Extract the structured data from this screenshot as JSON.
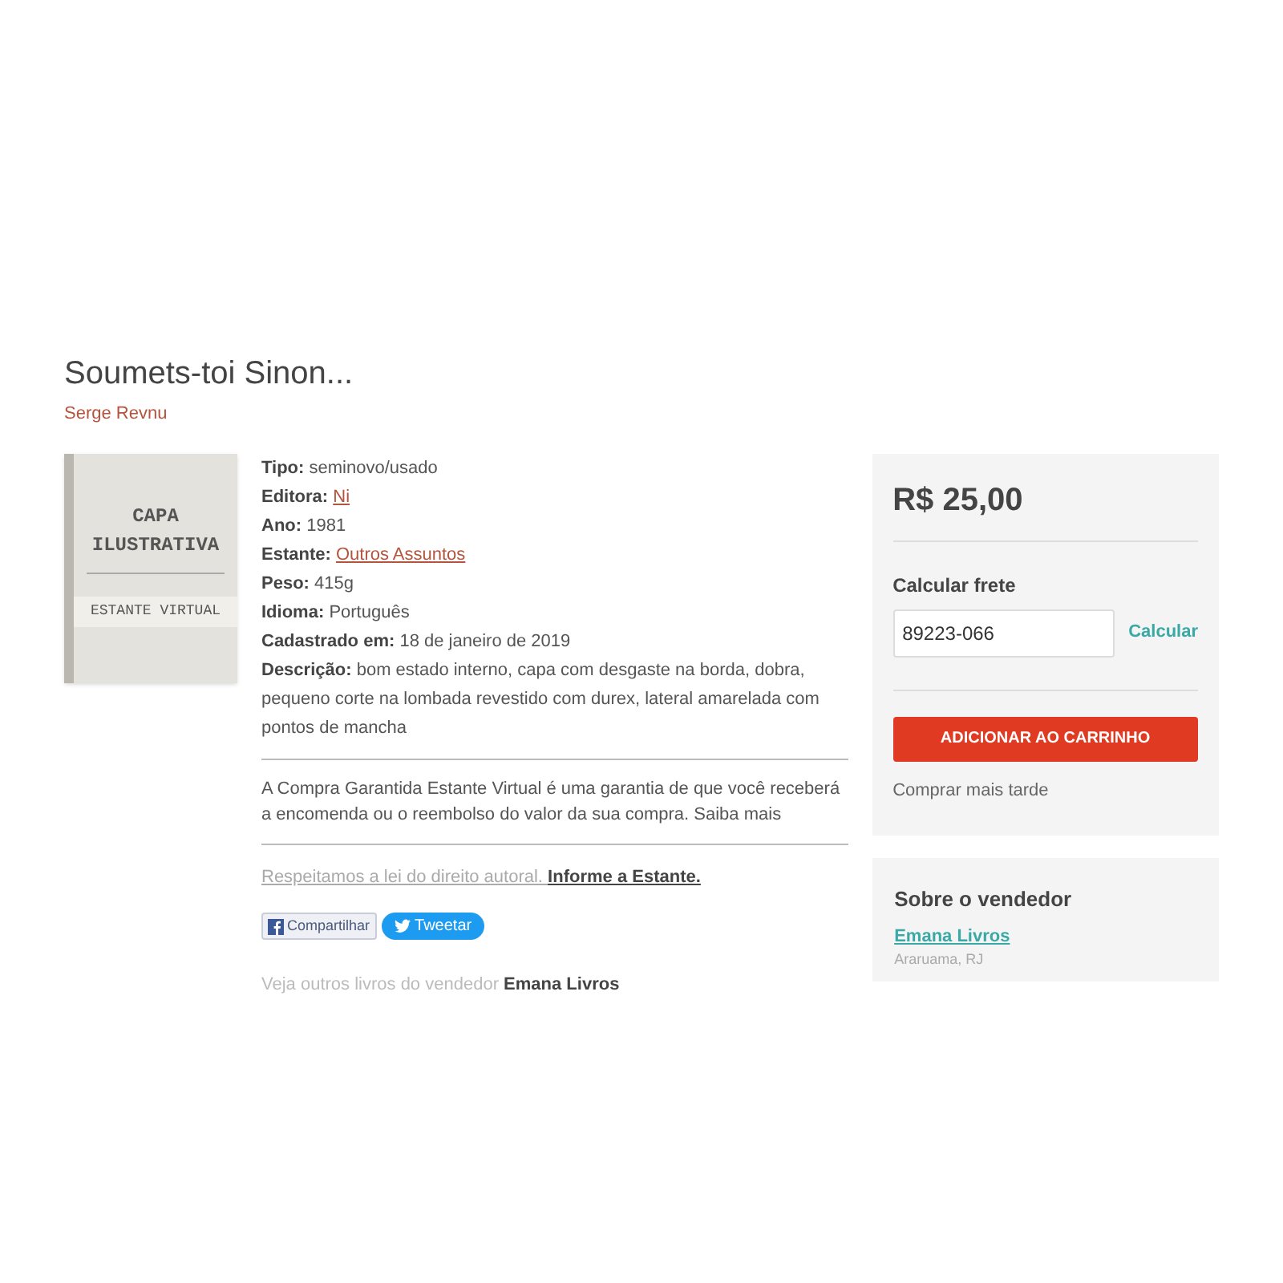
{
  "book": {
    "title": "Soumets-toi Sinon...",
    "author": "Serge Revnu"
  },
  "cover": {
    "line_1": "CAPA",
    "line_2": "ILUSTRATIVA",
    "footer": "ESTANTE VIRTUAL"
  },
  "details": [
    {
      "label": "Tipo:",
      "value": "seminovo/usado",
      "kind": "text"
    },
    {
      "label": "Editora:",
      "value": "Ni",
      "kind": "link"
    },
    {
      "label": "Ano:",
      "value": "1981",
      "kind": "text"
    },
    {
      "label": "Estante:",
      "value": "Outros Assuntos",
      "kind": "link"
    },
    {
      "label": "Peso:",
      "value": "415g",
      "kind": "text"
    },
    {
      "label": "Idioma:",
      "value": "Português",
      "kind": "text"
    },
    {
      "label": "Cadastrado em:",
      "value": "18 de janeiro de 2019",
      "kind": "text"
    },
    {
      "label": "Descrição:",
      "value": "bom estado interno, capa com desgaste na borda, dobra, pequeno corte na lombada revestido com durex, lateral amarelada com pontos de mancha",
      "kind": "text"
    }
  ],
  "guarantee": "A Compra Garantida Estante Virtual é uma garantia de que você receberá a encomenda ou o reembolso do valor da sua compra. Saiba mais",
  "copyright": {
    "text": "Respeitamos a lei do direito autoral.",
    "link": "Informe a Estante."
  },
  "share": {
    "facebook": "Compartilhar",
    "twitter": "Tweetar"
  },
  "more_from_seller": {
    "text": "Veja outros livros do vendedor",
    "seller": "Emana Livros"
  },
  "purchase": {
    "price": "R$ 25,00",
    "shipping_heading": "Calcular frete",
    "zip_value": "89223-066",
    "calculate": "Calcular",
    "add_to_cart": "ADICIONAR AO CARRINHO",
    "buy_later": "Comprar mais tarde"
  },
  "seller": {
    "heading": "Sobre o vendedor",
    "name": "Emana Livros",
    "location": "Araruama, RJ"
  }
}
